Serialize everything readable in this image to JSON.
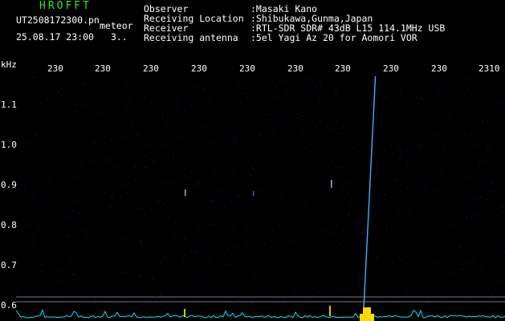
{
  "header": {
    "logo": "HROFFT",
    "filename": "UT2508172300.pn",
    "event_type": "meteor",
    "date_time": "25.08.17 23:00",
    "duration": "3..",
    "info": [
      {
        "label": "Observer",
        "value": ":Masaki Kano"
      },
      {
        "label": "Receiving Location",
        "value": ":Shibukawa,Gunma,Japan"
      },
      {
        "label": "Receiver",
        "value": ":RTL-SDR SDR# 43dB L15 114.1MHz USB"
      },
      {
        "label": "Receiving antenna",
        "value": ":5el Yagi Az 20 for Aomori VOR"
      }
    ]
  },
  "axes": {
    "y_unit": "kHz",
    "y_ticks": [
      "1.1",
      "1.0",
      "0.9",
      "0.8",
      "0.7",
      "0.6"
    ],
    "x_ticks": [
      "230",
      "230",
      "230",
      "230",
      "230",
      "230",
      "230",
      "230",
      "230",
      "2310"
    ]
  },
  "colors": {
    "background": "#000000",
    "noise": "#1a1a8c",
    "signal": "#3fb0ff",
    "baseline": "#00e5ff",
    "marker": "#e6c200",
    "text": "#ffffff",
    "logo": "#2ee62e"
  }
}
